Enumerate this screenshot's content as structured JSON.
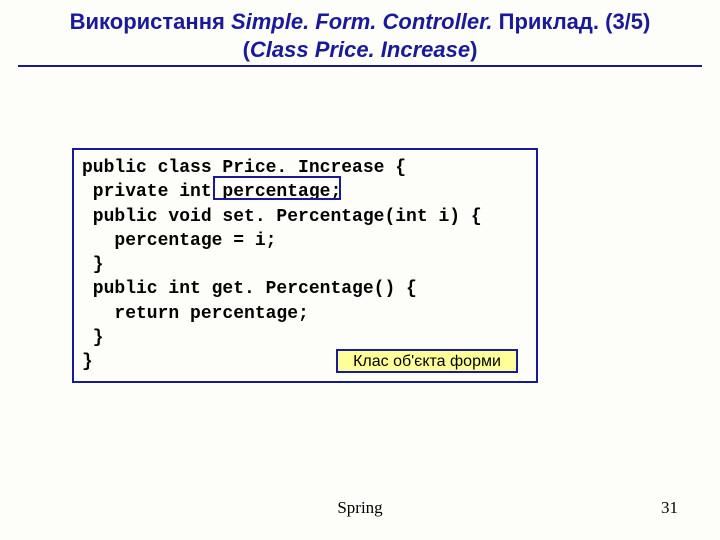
{
  "title": {
    "part1": "Використання ",
    "italic1": "Simple. Form. Controller. ",
    "part2": "Приклад. (3/5)",
    "part3": "(",
    "italic2": "Class Price. Increase",
    "part4": ")"
  },
  "code": {
    "line1": "public class Price. Increase {",
    "line2": " private int percentage;",
    "line3": " public void set. Percentage(int i) {",
    "line4": "   percentage = i;",
    "line5": " }",
    "line6": " public int get. Percentage() {",
    "line7": "   return percentage;",
    "line8": " }",
    "line9": "}"
  },
  "annotation": {
    "label": "Клас об'єкта форми"
  },
  "footer": {
    "center": "Spring",
    "page": "31"
  }
}
